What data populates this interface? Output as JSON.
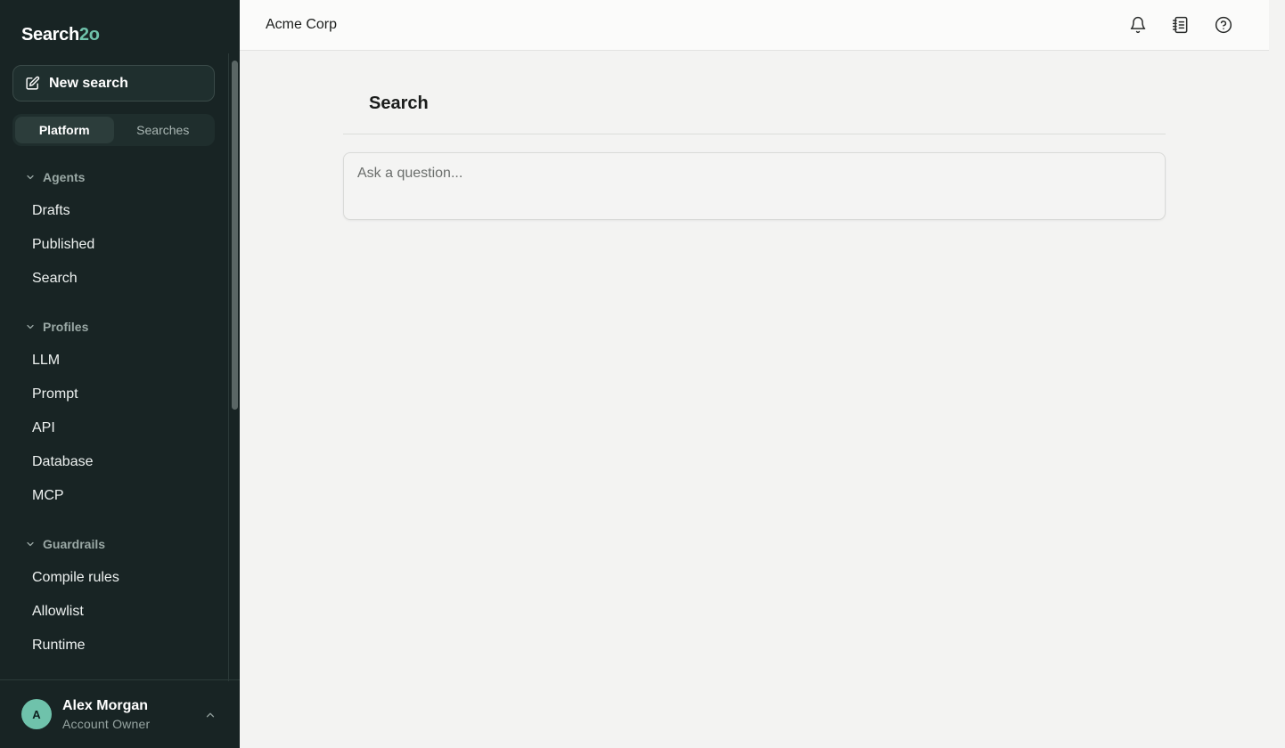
{
  "brand": {
    "main": "Search",
    "accent": "2o"
  },
  "sidebar": {
    "new_search_label": "New search",
    "tabs": [
      {
        "label": "Platform",
        "active": true
      },
      {
        "label": "Searches",
        "active": false
      }
    ],
    "sections": [
      {
        "title": "Agents",
        "expanded": true,
        "items": [
          "Drafts",
          "Published",
          "Search"
        ]
      },
      {
        "title": "Profiles",
        "expanded": true,
        "items": [
          "LLM",
          "Prompt",
          "API",
          "Database",
          "MCP"
        ]
      },
      {
        "title": "Guardrails",
        "expanded": true,
        "items": [
          "Compile rules",
          "Allowlist",
          "Runtime"
        ]
      }
    ]
  },
  "user": {
    "initial": "A",
    "name": "Alex Morgan",
    "role": "Account Owner"
  },
  "header": {
    "org_name": "Acme Corp",
    "icons": [
      "bell-icon",
      "notebook-icon",
      "help-icon"
    ]
  },
  "main": {
    "title": "Search",
    "input_placeholder": "Ask a question...",
    "input_value": ""
  },
  "colors": {
    "sidebar_bg": "#182424",
    "accent": "#6fc2ab",
    "page_bg": "#f3f3f2"
  }
}
